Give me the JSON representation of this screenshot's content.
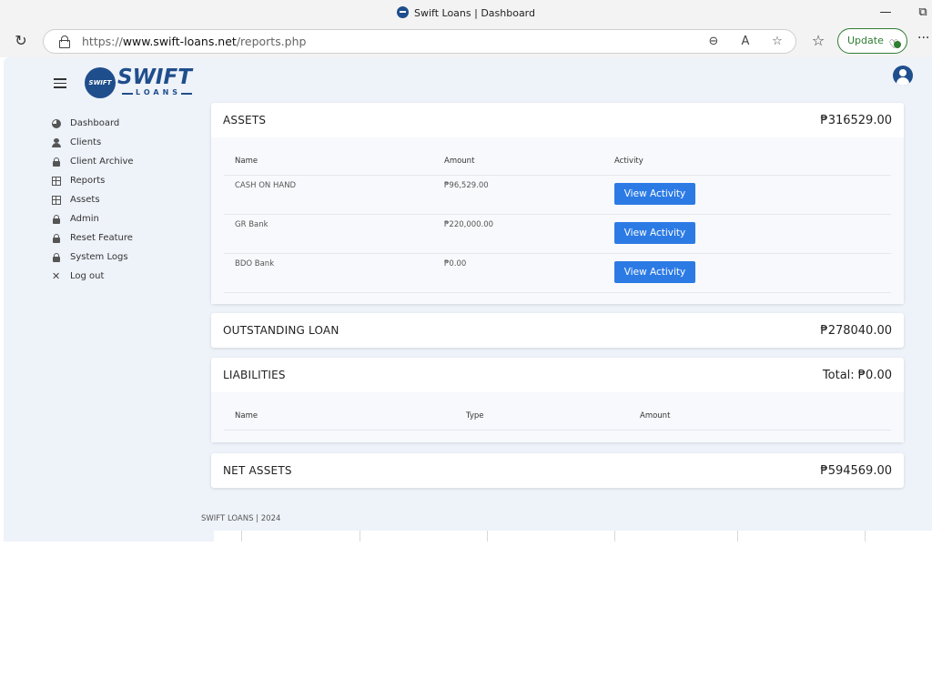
{
  "browser": {
    "tab_title": "Swift Loans | Dashboard",
    "url_prefix": "https://",
    "url_host": "www.swift-loans.net",
    "url_path": "/reports.php",
    "update_label": "Update",
    "icons": [
      "refresh-icon",
      "lock-icon",
      "zoom-out-icon",
      "read-aloud-icon",
      "favorite-star-icon",
      "favorites-list-icon",
      "more-icon"
    ]
  },
  "brand": {
    "logo_circle": "SWIFT",
    "name": "SWIFT",
    "sub": "LOANS",
    "color": "#1f4e8c"
  },
  "sidebar": {
    "items": [
      {
        "label": "Dashboard",
        "icon": "pie-chart-icon"
      },
      {
        "label": "Clients",
        "icon": "user-icon"
      },
      {
        "label": "Client Archive",
        "icon": "lock-icon"
      },
      {
        "label": "Reports",
        "icon": "table-icon"
      },
      {
        "label": "Assets",
        "icon": "table-icon"
      },
      {
        "label": "Admin",
        "icon": "lock-icon"
      },
      {
        "label": "Reset Feature",
        "icon": "lock-icon"
      },
      {
        "label": "System Logs",
        "icon": "lock-icon"
      },
      {
        "label": "Log out",
        "icon": "close-icon"
      }
    ]
  },
  "assets": {
    "title": "ASSETS",
    "total": "₱316529.00",
    "columns": [
      "Name",
      "Amount",
      "Activity"
    ],
    "rows": [
      {
        "name": "CASH ON HAND",
        "amount": "₱96,529.00",
        "action": "View Activity"
      },
      {
        "name": "GR Bank",
        "amount": "₱220,000.00",
        "action": "View Activity"
      },
      {
        "name": "BDO Bank",
        "amount": "₱0.00",
        "action": "View Activity"
      }
    ]
  },
  "outstanding": {
    "title": "OUTSTANDING LOAN",
    "total": "₱278040.00"
  },
  "liabilities": {
    "title": "LIABILITIES",
    "total": "Total: ₱0.00",
    "columns": [
      "Name",
      "Type",
      "Amount"
    ]
  },
  "net_assets": {
    "title": "NET ASSETS",
    "total": "₱594569.00"
  },
  "footer": {
    "text": "SWIFT LOANS | 2024"
  },
  "colors": {
    "accent": "#2c7be5",
    "page_bg": "#eef2f9",
    "update_green": "#2e7d32"
  }
}
